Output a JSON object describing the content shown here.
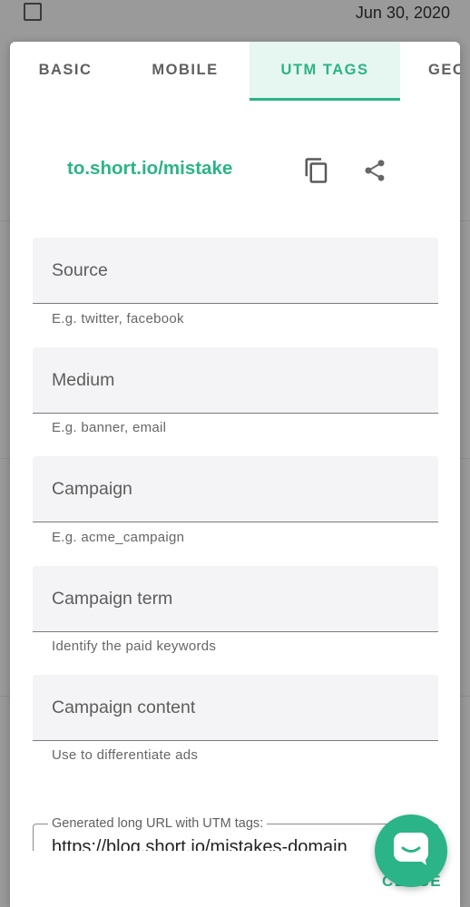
{
  "background": {
    "date": "Jun 30, 2020"
  },
  "tabs": [
    {
      "label": "BASIC"
    },
    {
      "label": "MOBILE"
    },
    {
      "label": "UTM TAGS",
      "active": true
    },
    {
      "label": "GEO"
    }
  ],
  "link": {
    "short_url": "to.short.io/mistake",
    "copy_icon": "copy-icon",
    "share_icon": "share-icon"
  },
  "fields": [
    {
      "label": "Source",
      "hint": "E.g. twitter, facebook"
    },
    {
      "label": "Medium",
      "hint": "E.g. banner, email"
    },
    {
      "label": "Campaign",
      "hint": "E.g. acme_campaign"
    },
    {
      "label": "Campaign term",
      "hint": "Identify the paid keywords"
    },
    {
      "label": "Campaign content",
      "hint": "Use to differentiate ads"
    }
  ],
  "generated": {
    "label": "Generated long URL with UTM tags:",
    "value": "https://blog.short.io/mistakes-domain"
  },
  "actions": {
    "close_label": "CLOSE"
  },
  "chat": {
    "icon": "chat-icon"
  },
  "colors": {
    "accent": "#2bb487",
    "active_tab_bg": "#e6f6f0"
  }
}
